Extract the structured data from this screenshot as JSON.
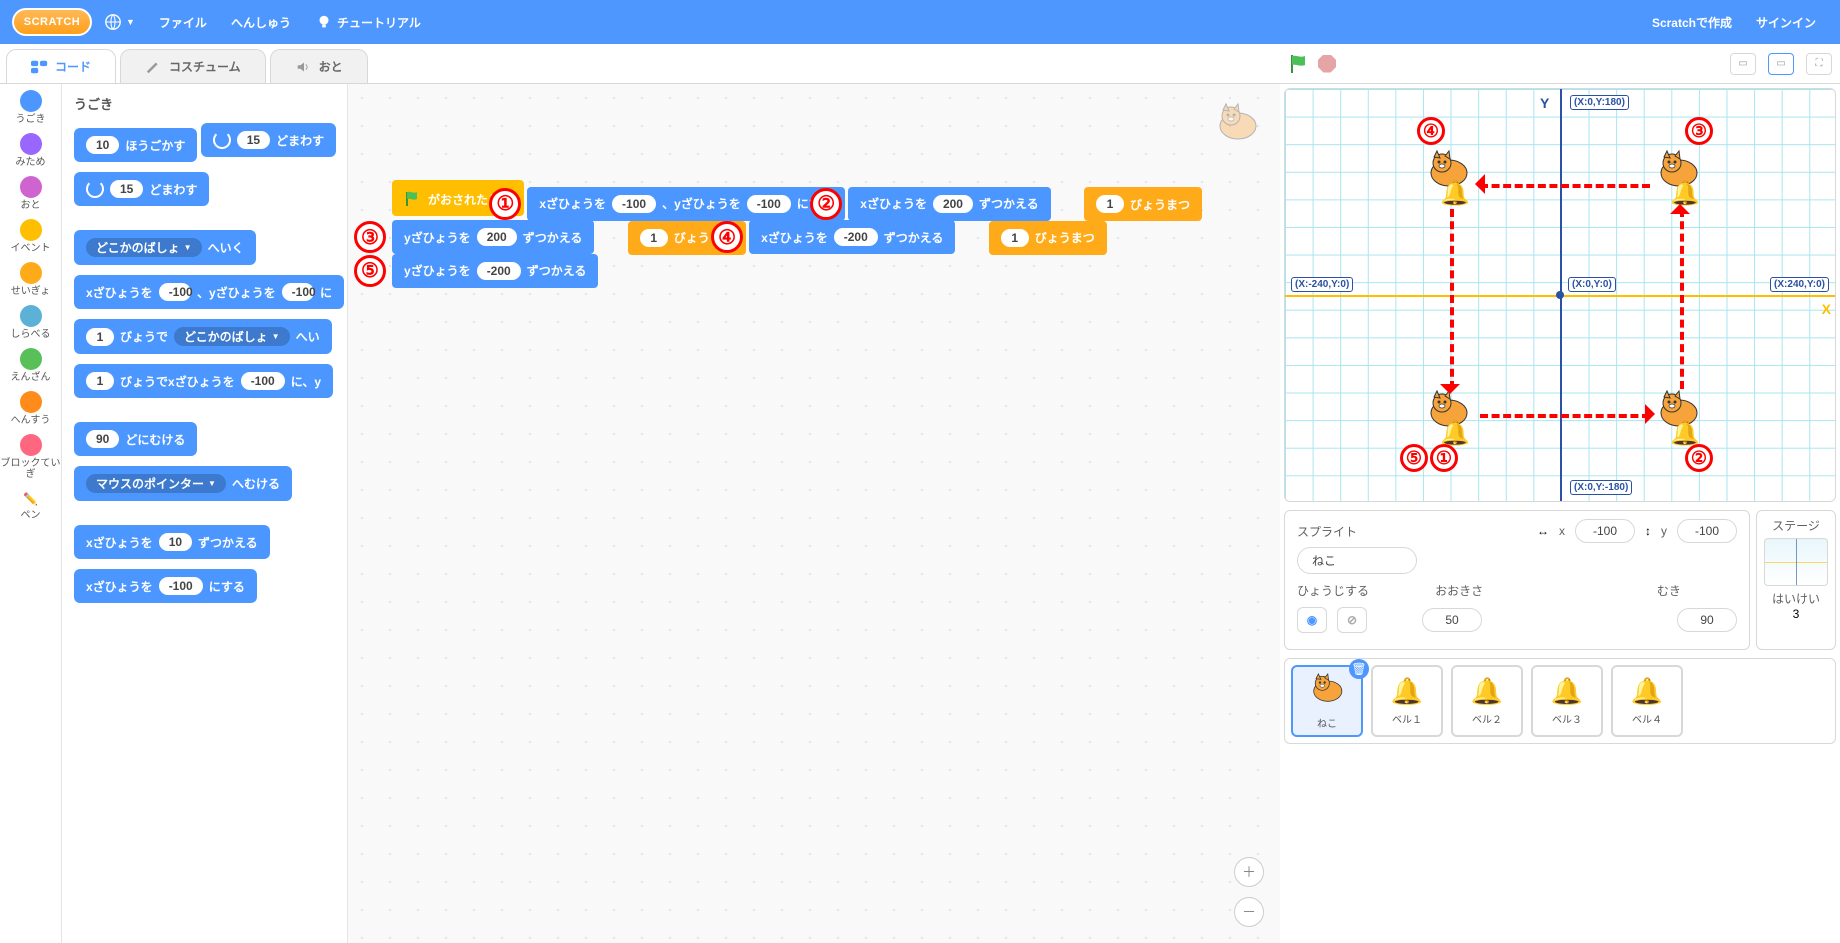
{
  "menu": {
    "logo": "SCRATCH",
    "file": "ファイル",
    "edit": "へんしゅう",
    "tutorials": "チュートリアル",
    "create": "Scratchで作成",
    "signin": "サインイン"
  },
  "tabs": {
    "code": "コード",
    "costumes": "コスチューム",
    "sounds": "おと"
  },
  "categories": [
    {
      "label": "うごき",
      "color": "#4c97ff"
    },
    {
      "label": "みため",
      "color": "#9966ff"
    },
    {
      "label": "おと",
      "color": "#cf63cf"
    },
    {
      "label": "イベント",
      "color": "#ffbf00"
    },
    {
      "label": "せいぎょ",
      "color": "#ffab19"
    },
    {
      "label": "しらべる",
      "color": "#5cb1d6"
    },
    {
      "label": "えんざん",
      "color": "#59c059"
    },
    {
      "label": "へんすう",
      "color": "#ff8c1a"
    },
    {
      "label": "ブロックていぎ",
      "color": "#ff6680"
    },
    {
      "label": "ペン",
      "color": "#0fbd8c"
    }
  ],
  "palette_title": "うごき",
  "palette_blocks": {
    "move_steps": {
      "pre": "",
      "val": "10",
      "post": "ほうごかす"
    },
    "turn_cw": {
      "val": "15",
      "post": "どまわす"
    },
    "turn_ccw": {
      "val": "15",
      "post": "どまわす"
    },
    "goto_random": {
      "pre": "",
      "dd": "どこかのばしょ",
      "post": "へいく"
    },
    "goto_xy": {
      "p1": "xざひょうを",
      "v1": "-100",
      "p2": "、yざひょうを",
      "v2": "-100",
      "p3": "に"
    },
    "glide_rand": {
      "v1": "1",
      "p1": "びょうで",
      "dd": "どこかのばしょ",
      "p2": "へい"
    },
    "glide_xy": {
      "v1": "1",
      "p1": "びょうでxざひょうを",
      "v2": "-100",
      "p2": "に、y"
    },
    "point_dir": {
      "v1": "90",
      "p1": "どにむける"
    },
    "point_to": {
      "dd": "マウスのポインター",
      "p1": "へむける"
    },
    "change_x": {
      "p1": "xざひょうを",
      "v1": "10",
      "p2": "ずつかえる"
    },
    "set_x": {
      "p1": "xざひょうを",
      "v1": "-100",
      "p2": "にする"
    }
  },
  "script": {
    "hat": "がおされたとき",
    "b1": {
      "p1": "xざひょうを",
      "v1": "-100",
      "p2": "、yざひょうを",
      "v2": "-100",
      "p3": "にする"
    },
    "b2": {
      "p1": "xざひょうを",
      "v1": "200",
      "p2": "ずつかえる"
    },
    "w1": {
      "v": "1",
      "p": "びょうまつ"
    },
    "b3": {
      "p1": "yざひょうを",
      "v1": "200",
      "p2": "ずつかえる"
    },
    "w2": {
      "v": "1",
      "p": "びょうまつ"
    },
    "b4": {
      "p1": "xざひょうを",
      "v1": "-200",
      "p2": "ずつかえる"
    },
    "w3": {
      "v": "1",
      "p": "びょうまつ"
    },
    "b5": {
      "p1": "yざひょうを",
      "v1": "-200",
      "p2": "ずつかえる"
    }
  },
  "annots": [
    "①",
    "②",
    "③",
    "④",
    "⑤"
  ],
  "stage_coords": {
    "top": "(X:0,Y:180)",
    "bottom": "(X:0,Y:-180)",
    "left": "(X:-240,Y:0)",
    "center": "(X:0,Y:0)",
    "right": "(X:240,Y:0)",
    "xaxis": "X",
    "yaxis": "Y"
  },
  "stage_annots": {
    "a1": "①",
    "a2": "②",
    "a3": "③",
    "a4": "④",
    "a5": "⑤"
  },
  "sprite_info": {
    "title": "スプライト",
    "name": "ねこ",
    "x_lbl": "x",
    "x_val": "-100",
    "y_lbl": "y",
    "y_val": "-100",
    "show_lbl": "ひょうじする",
    "size_lbl": "おおきさ",
    "size_val": "50",
    "dir_lbl": "むき",
    "dir_val": "90"
  },
  "stage_panel": {
    "title": "ステージ",
    "backdrops_lbl": "はいけい",
    "backdrops_n": "3"
  },
  "sprites": [
    {
      "name": "ねこ",
      "active": true,
      "icon": "cat"
    },
    {
      "name": "ベル１",
      "active": false,
      "icon": "bell",
      "color": "#f0b400"
    },
    {
      "name": "ベル２",
      "active": false,
      "icon": "bell",
      "color": "#e8397a"
    },
    {
      "name": "ベル３",
      "active": false,
      "icon": "bell",
      "color": "#2542b3"
    },
    {
      "name": "ベル４",
      "active": false,
      "icon": "bell",
      "color": "#2fa84c"
    }
  ]
}
